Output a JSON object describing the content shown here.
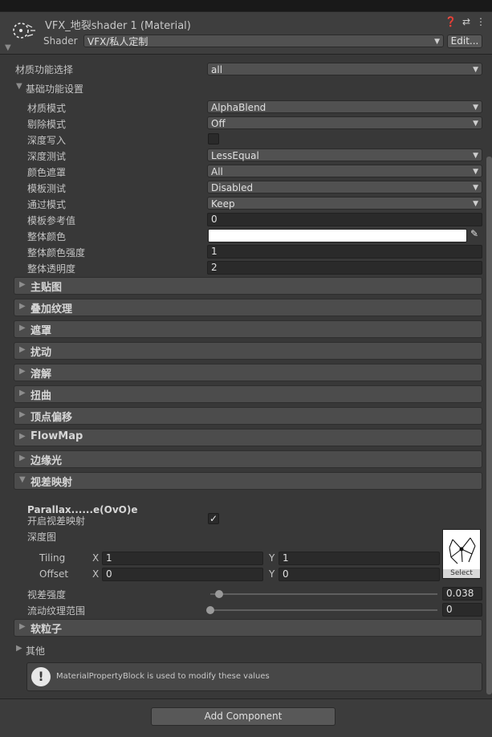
{
  "material": {
    "title": "VFX_地裂shader 1 (Material)",
    "shader_label": "Shader",
    "shader_value": "VFX/私人定制",
    "edit_button": "Edit...",
    "header_icons": [
      "help-icon",
      "sliders-icon",
      "kebab-menu-icon"
    ]
  },
  "material_function": {
    "label": "材质功能选择",
    "value": "all"
  },
  "basic": {
    "title": "基础功能设置",
    "blend_mode": {
      "label": "材质模式",
      "value": "AlphaBlend"
    },
    "cull_mode": {
      "label": "剔除模式",
      "value": "Off"
    },
    "zwrite": {
      "label": "深度写入",
      "checked": false
    },
    "ztest": {
      "label": "深度测试",
      "value": "LessEqual"
    },
    "color_mask": {
      "label": "颜色遮罩",
      "value": "All"
    },
    "stencil_test": {
      "label": "模板测试",
      "value": "Disabled"
    },
    "pass_mode": {
      "label": "通过模式",
      "value": "Keep"
    },
    "stencil_ref": {
      "label": "模板参考值",
      "value": "0"
    },
    "color": {
      "label": "整体颜色",
      "value": "#ffffff"
    },
    "color_intensity": {
      "label": "整体颜色强度",
      "value": "1"
    },
    "opacity": {
      "label": "整体透明度",
      "value": "2"
    }
  },
  "sections": [
    "主贴图",
    "叠加纹理",
    "遮罩",
    "扰动",
    "溶解",
    "扭曲",
    "顶点偏移",
    "FlowMap",
    "边缘光"
  ],
  "parallax": {
    "title": "视差映射",
    "subheader": "Parallax......e(OvO)e",
    "enable_label": "开启视差映射",
    "enable_checked": true,
    "depth_map_label": "深度图",
    "tiling_label": "Tiling",
    "offset_label": "Offset",
    "x_label": "X",
    "y_label": "Y",
    "tiling_x": "1",
    "tiling_y": "1",
    "offset_x": "0",
    "offset_y": "0",
    "select_label": "Select",
    "strength_label": "视差强度",
    "strength_value": "0.038",
    "strength_fraction": 0.038,
    "flow_label": "流动纹理范围",
    "flow_value": "0",
    "flow_fraction": 0
  },
  "soft_particle": {
    "title": "软粒子"
  },
  "other": {
    "title": "其他"
  },
  "help": {
    "text": "MaterialPropertyBlock is used to modify these values"
  },
  "add_component": "Add Component",
  "colors": {
    "panel": "#383838",
    "header": "#3e3e3e",
    "section": "#4c4c4c",
    "field": "#2a2a2a"
  }
}
